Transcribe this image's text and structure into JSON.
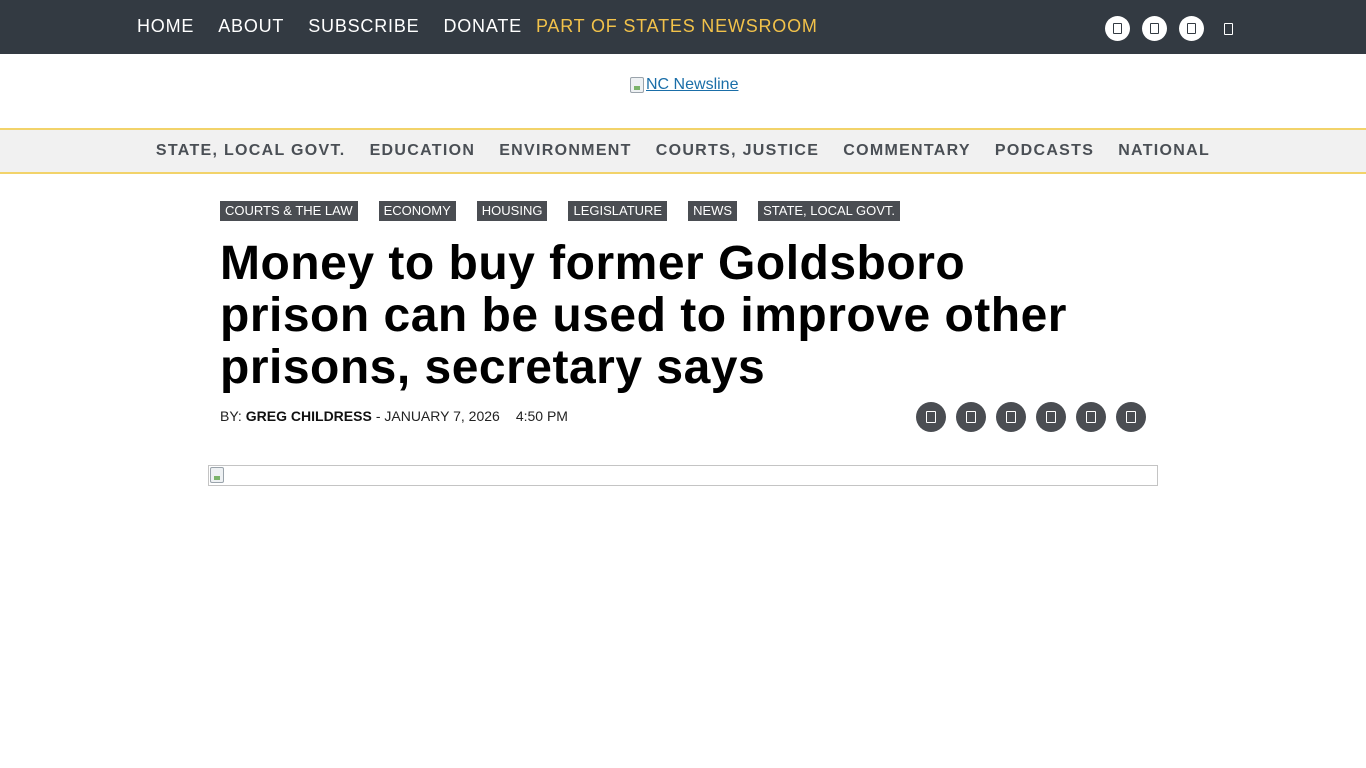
{
  "top_nav": {
    "items": [
      "HOME",
      "ABOUT",
      "SUBSCRIBE",
      "DONATE"
    ],
    "states_newsroom": "PART OF STATES NEWSROOM",
    "social_icons": [
      "facebook-icon",
      "twitter-icon",
      "instagram-icon"
    ],
    "search_icon": "search-icon",
    "colors": {
      "bar": "#333a42",
      "accent": "#f2c24a"
    }
  },
  "logo": {
    "alt": "NC Newsline"
  },
  "section_nav": {
    "items": [
      "STATE, LOCAL GOVT.",
      "EDUCATION",
      "ENVIRONMENT",
      "COURTS, JUSTICE",
      "COMMENTARY",
      "PODCASTS",
      "NATIONAL"
    ]
  },
  "article": {
    "tags": [
      "COURTS & THE LAW",
      "ECONOMY",
      "HOUSING",
      "LEGISLATURE",
      "NEWS",
      "STATE, LOCAL GOVT."
    ],
    "title": "Money to buy former Goldsboro prison can be used to improve other prisons, secretary says",
    "byline": {
      "prefix": "BY:",
      "author": "GREG CHILDRESS",
      "date": "- JANUARY 7, 2026",
      "time": "4:50 PM"
    },
    "share_icons": [
      "facebook-icon",
      "twitter-icon",
      "email-icon",
      "linkedin-icon",
      "reddit-icon",
      "print-icon"
    ]
  }
}
